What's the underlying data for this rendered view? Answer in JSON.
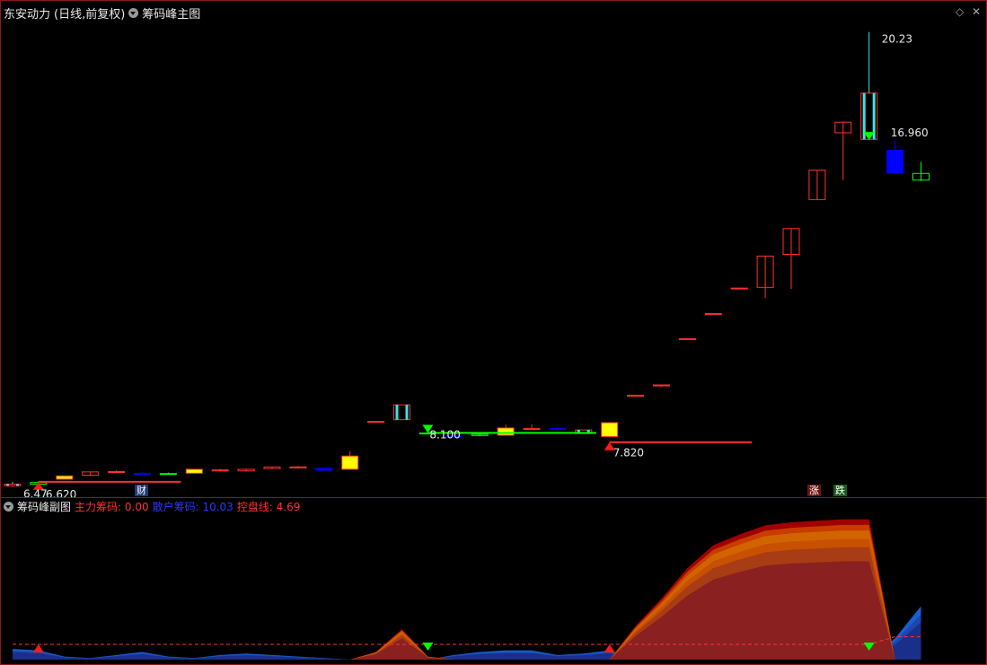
{
  "main": {
    "stock_name": "东安动力",
    "period": "(日线,前复权)",
    "indicator": "筹码峰主图",
    "price_labels": {
      "high": "20.23",
      "low": "6.47",
      "signal_high": "16.960",
      "signal_mid": "8.100",
      "signal_low": "7.820",
      "bottom_left": "6.620"
    },
    "badges": {
      "cai": "财",
      "zhang": "涨",
      "die": "跌"
    }
  },
  "sub": {
    "indicator": "筹码峰副图",
    "zhuli_label": "主力筹码: 0.00",
    "sanhu_label": "散户筹码: 10.03",
    "kongpan_label": "控盘线: 4.69"
  },
  "colors": {
    "border": "#8b1a1a",
    "up": "#ff3030",
    "down_cyan": "#40e0e0",
    "yellow": "#ffff00",
    "blue": "#0000ff",
    "green": "#00ff00",
    "zhuli": "#ff3333",
    "sanhu": "#3333ff",
    "kongpan": "#ff3333"
  },
  "chart_data": {
    "type": "candlestick",
    "candles": [
      {
        "o": 6.55,
        "h": 6.62,
        "l": 6.47,
        "c": 6.5,
        "s": "cyan"
      },
      {
        "o": 6.55,
        "h": 6.64,
        "l": 6.49,
        "c": 6.6,
        "s": "green"
      },
      {
        "o": 6.7,
        "h": 6.8,
        "l": 6.7,
        "c": 6.8,
        "s": "yellow"
      },
      {
        "o": 6.82,
        "h": 6.93,
        "l": 6.8,
        "c": 6.92,
        "s": "red"
      },
      {
        "o": 6.93,
        "h": 6.97,
        "l": 6.9,
        "c": 6.93,
        "s": "red"
      },
      {
        "o": 6.86,
        "h": 6.93,
        "l": 6.84,
        "c": 6.87,
        "s": "blue"
      },
      {
        "o": 6.86,
        "h": 6.9,
        "l": 6.84,
        "c": 6.87,
        "s": "green"
      },
      {
        "o": 6.88,
        "h": 7.0,
        "l": 6.88,
        "c": 7.0,
        "s": "yellow"
      },
      {
        "o": 6.95,
        "h": 7.02,
        "l": 6.93,
        "c": 6.98,
        "s": "red"
      },
      {
        "o": 6.95,
        "h": 7.0,
        "l": 6.93,
        "c": 7.0,
        "s": "red"
      },
      {
        "o": 7.02,
        "h": 7.07,
        "l": 7.02,
        "c": 7.07,
        "s": "red"
      },
      {
        "o": 7.05,
        "h": 7.1,
        "l": 7.02,
        "c": 7.07,
        "s": "red"
      },
      {
        "o": 7.03,
        "h": 7.05,
        "l": 6.95,
        "c": 6.97,
        "s": "blue"
      },
      {
        "o": 7.4,
        "h": 7.55,
        "l": 7.0,
        "c": 7.0,
        "s": "yellow"
      },
      {
        "o": 8.45,
        "h": 8.45,
        "l": 8.45,
        "c": 8.45,
        "s": "red"
      },
      {
        "o": 8.5,
        "h": 8.95,
        "l": 8.5,
        "c": 8.95,
        "s": "cyan"
      },
      {
        "o": 8.07,
        "h": 8.13,
        "l": 8.06,
        "c": 8.1,
        "s": "green"
      },
      {
        "o": 7.98,
        "h": 8.08,
        "l": 7.95,
        "c": 8.0,
        "s": "blue"
      },
      {
        "o": 8.02,
        "h": 8.1,
        "l": 8.0,
        "c": 8.06,
        "s": "green"
      },
      {
        "o": 8.03,
        "h": 8.35,
        "l": 8.03,
        "c": 8.25,
        "s": "yellow"
      },
      {
        "o": 8.21,
        "h": 8.35,
        "l": 8.2,
        "c": 8.23,
        "s": "red"
      },
      {
        "o": 8.23,
        "h": 8.28,
        "l": 8.19,
        "c": 8.23,
        "s": "blue"
      },
      {
        "o": 8.08,
        "h": 8.19,
        "l": 8.08,
        "c": 8.19,
        "s": "cyan"
      },
      {
        "o": 7.99,
        "h": 8.41,
        "l": 7.95,
        "c": 8.41,
        "s": "yellow"
      },
      {
        "o": 9.24,
        "h": 9.24,
        "l": 9.24,
        "c": 9.24,
        "s": "red"
      },
      {
        "o": 9.55,
        "h": 9.55,
        "l": 9.5,
        "c": 9.55,
        "s": "red"
      },
      {
        "o": 10.95,
        "h": 10.95,
        "l": 10.95,
        "c": 10.95,
        "s": "red"
      },
      {
        "o": 11.71,
        "h": 11.71,
        "l": 11.71,
        "c": 11.71,
        "s": "red"
      },
      {
        "o": 12.48,
        "h": 12.48,
        "l": 12.48,
        "c": 12.48,
        "s": "red"
      },
      {
        "o": 12.5,
        "h": 13.45,
        "l": 12.18,
        "c": 13.45,
        "s": "red"
      },
      {
        "o": 13.5,
        "h": 14.28,
        "l": 12.45,
        "c": 14.28,
        "s": "red"
      },
      {
        "o": 15.16,
        "h": 16.05,
        "l": 15.16,
        "c": 16.05,
        "s": "red"
      },
      {
        "o": 17.18,
        "h": 17.5,
        "l": 15.75,
        "c": 17.5,
        "s": "red"
      },
      {
        "o": 18.38,
        "h": 20.23,
        "l": 16.96,
        "c": 16.98,
        "s": "cyan"
      },
      {
        "o": 15.96,
        "h": 16.96,
        "l": 15.96,
        "c": 16.65,
        "s": "blue"
      },
      {
        "o": 15.75,
        "h": 16.3,
        "l": 15.72,
        "c": 15.95,
        "s": "green"
      }
    ],
    "signals": [
      {
        "kind": "buy",
        "index": 1,
        "price": 6.62
      },
      {
        "kind": "sell",
        "index": 16,
        "price": 8.1
      },
      {
        "kind": "buy",
        "index": 23,
        "price": 7.82
      },
      {
        "kind": "sell",
        "index": 33,
        "price": 16.96
      }
    ],
    "support_lines": [
      {
        "from": 1,
        "to": 6,
        "price": 6.62,
        "color": "red"
      },
      {
        "from": 16,
        "to": 22,
        "price": 8.1,
        "color": "green"
      },
      {
        "from": 23,
        "to": 28,
        "price": 7.82,
        "color": "red"
      }
    ],
    "ylim": [
      6.4,
      20.6
    ],
    "sub_chart": {
      "type": "area",
      "zhuli": [
        0,
        0,
        0,
        0,
        0,
        0,
        0,
        0,
        0,
        0,
        0,
        0,
        0,
        0,
        5,
        20,
        2,
        0,
        0,
        0,
        0,
        0,
        0,
        0,
        22,
        40,
        60,
        75,
        82,
        88,
        90,
        91,
        92,
        92,
        0,
        0
      ],
      "sanhu": [
        7,
        6,
        2,
        1,
        3,
        5,
        2,
        1,
        3,
        4,
        3,
        2,
        1,
        0,
        0,
        0,
        0,
        3,
        5,
        6,
        6,
        3,
        4,
        6,
        0,
        0,
        0,
        0,
        0,
        0,
        0,
        0,
        0,
        0,
        14,
        35
      ],
      "kongpan": [
        10,
        10,
        10,
        10,
        10,
        10,
        10,
        10,
        10,
        10,
        10,
        10,
        10,
        10,
        10,
        10,
        10,
        10,
        10,
        10,
        10,
        10,
        10,
        10,
        10,
        10,
        10,
        10,
        10,
        10,
        10,
        10,
        10,
        10,
        15,
        15
      ],
      "ylim": [
        0,
        100
      ]
    }
  }
}
